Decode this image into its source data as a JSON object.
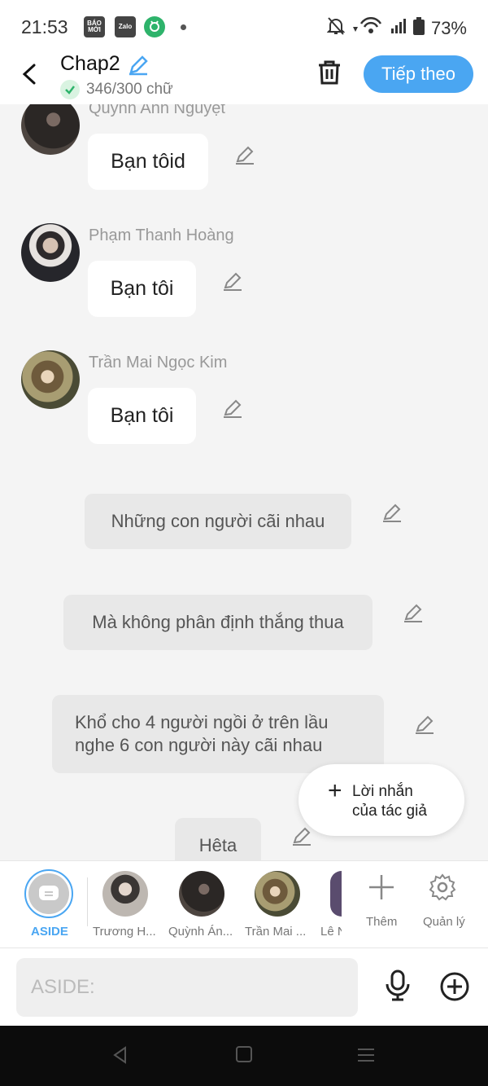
{
  "status_bar": {
    "time": "21:53",
    "apps": [
      "BÁO MỚI",
      "Zalo",
      "app"
    ],
    "battery": "73%",
    "icons": [
      "bell-off-icon",
      "wifi-icon",
      "signal-icon",
      "battery-icon"
    ]
  },
  "header": {
    "title": "Chap2",
    "count": "346/300 chữ",
    "next_label": "Tiếp theo"
  },
  "messages": [
    {
      "name": "Quỳnh Anh Nguyệt",
      "text": "Bạn tôid"
    },
    {
      "name": "Phạm Thanh Hoàng",
      "text": "Bạn tôi"
    },
    {
      "name": "Trần Mai Ngọc Kim",
      "text": "Bạn tôi"
    }
  ],
  "asides": [
    {
      "text": "Những con người cãi nhau"
    },
    {
      "text": "Mà không phân định thắng thua"
    },
    {
      "line1": "Khổ cho 4 người ngồi ở trên lầu",
      "line2": "nghe 6 con người này cãi nhau"
    },
    {
      "text": "Hêta"
    }
  ],
  "author_note": {
    "plus": "+",
    "line1": "Lời nhắn",
    "line2": "của tác giả"
  },
  "characters": {
    "aside_label": "ASIDE",
    "items": [
      {
        "label": "Trương H..."
      },
      {
        "label": "Quỳnh Án..."
      },
      {
        "label": "Trần Mai ..."
      },
      {
        "label": "Lê N"
      }
    ],
    "add_label": "Thêm",
    "manage_label": "Quản lý"
  },
  "input": {
    "placeholder": "ASIDE:"
  }
}
